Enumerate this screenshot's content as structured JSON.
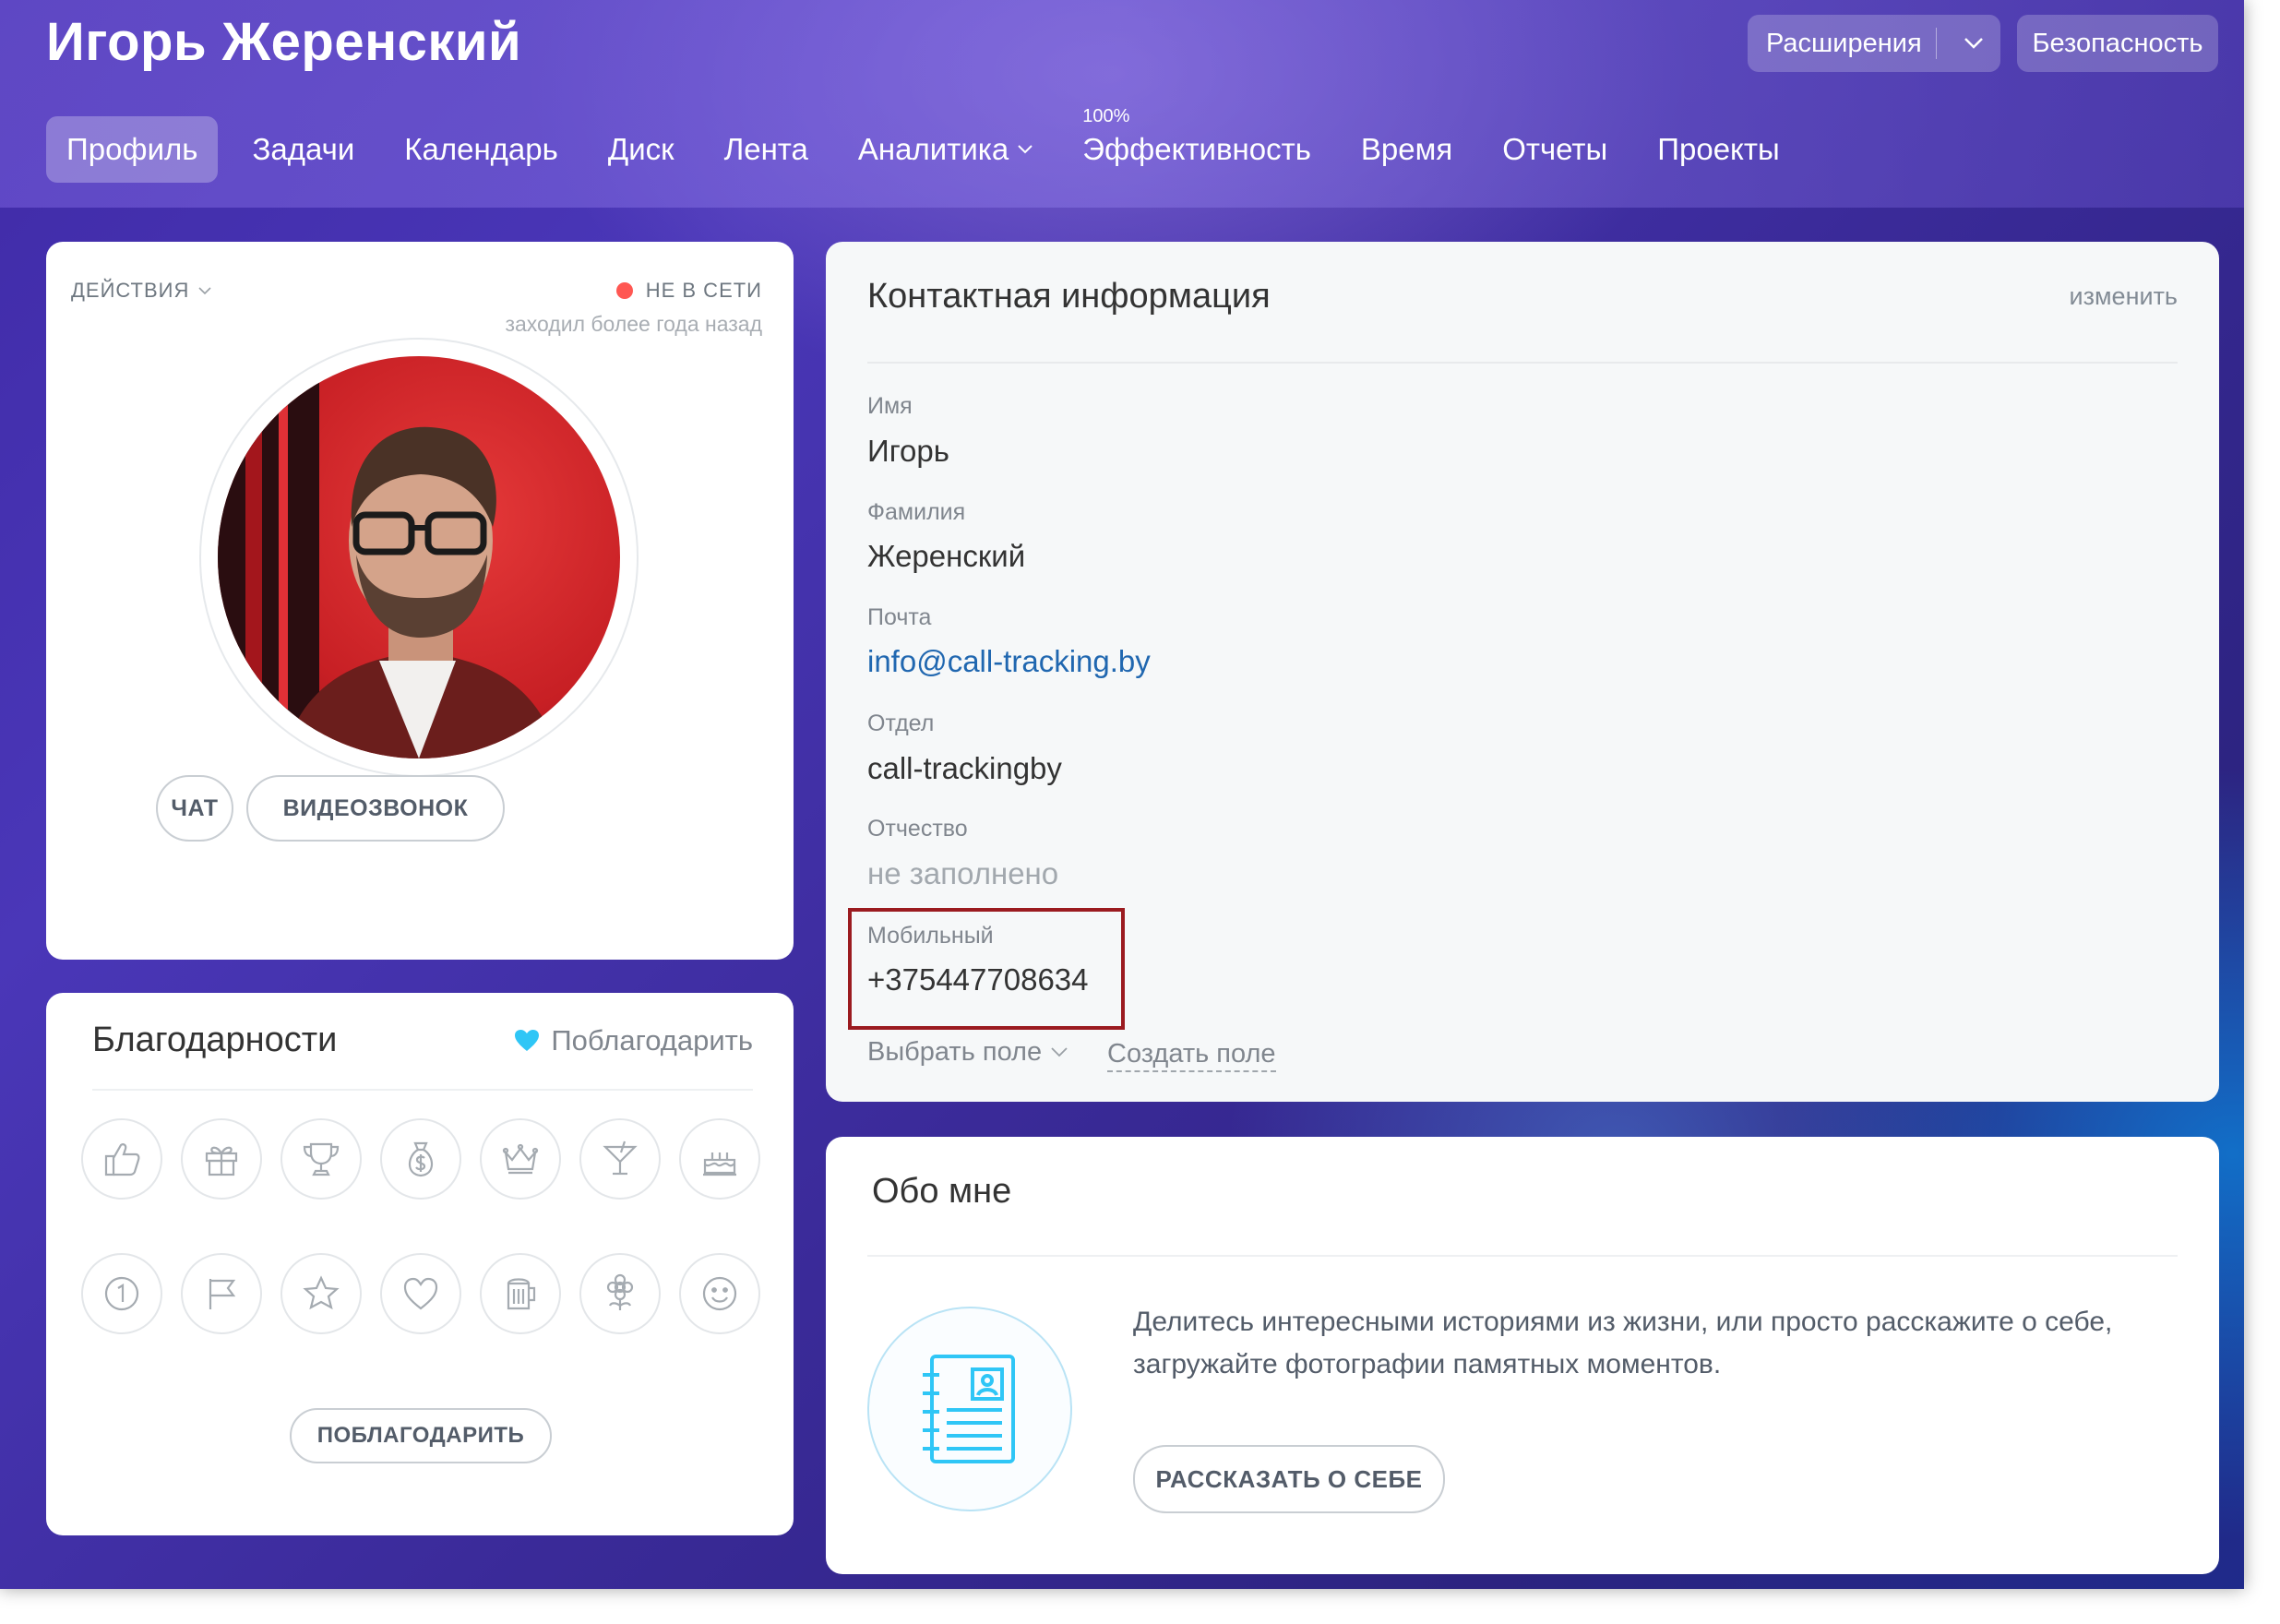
{
  "header": {
    "user_name": "Игорь Жеренский",
    "extensions_label": "Расширения",
    "security_label": "Безопасность"
  },
  "nav": {
    "items": [
      {
        "label": "Профиль"
      },
      {
        "label": "Задачи"
      },
      {
        "label": "Календарь"
      },
      {
        "label": "Диск"
      },
      {
        "label": "Лента"
      },
      {
        "label": "Аналитика"
      },
      {
        "label": "Эффективность",
        "badge": "100%"
      },
      {
        "label": "Время"
      },
      {
        "label": "Отчеты"
      },
      {
        "label": "Проекты"
      }
    ]
  },
  "profile_card": {
    "actions_label": "ДЕЙСТВИЯ",
    "status_label": "НЕ В СЕТИ",
    "last_seen": "заходил более года назад",
    "chat_button": "ЧАТ",
    "video_button": "ВИДЕОЗВОНОК",
    "status_color": "#ff5752"
  },
  "thanks_card": {
    "title": "Благодарности",
    "thank_link": "Поблагодарить",
    "thank_button": "ПОБЛАГОДАРИТЬ",
    "badges_row1": [
      "thumbs-up-icon",
      "gift-icon",
      "trophy-icon",
      "money-bag-icon",
      "crown-icon",
      "cocktail-icon",
      "cake-icon"
    ],
    "badges_row2": [
      "number-one-icon",
      "flag-icon",
      "star-icon",
      "heart-icon",
      "beer-icon",
      "flower-icon",
      "smile-icon"
    ]
  },
  "contact_card": {
    "title": "Контактная информация",
    "edit_link": "изменить",
    "fields": [
      {
        "label": "Имя",
        "value": "Игорь"
      },
      {
        "label": "Фамилия",
        "value": "Жеренский"
      },
      {
        "label": "Почта",
        "value": "info@call-tracking.by"
      },
      {
        "label": "Отдел",
        "value": "call-trackingby"
      },
      {
        "label": "Отчество",
        "value": "не заполнено"
      },
      {
        "label": "Мобильный",
        "value": "+375447708634"
      }
    ],
    "choose_field": "Выбрать поле",
    "create_field": "Создать поле",
    "highlight_color": "#9b1b20"
  },
  "about_card": {
    "title": "Обо мне",
    "text": "Делитесь интересными историями из жизни, или просто расскажите о себе, загружайте фотографии памятных моментов.",
    "button": "РАССКАЗАТЬ О СЕБЕ"
  }
}
